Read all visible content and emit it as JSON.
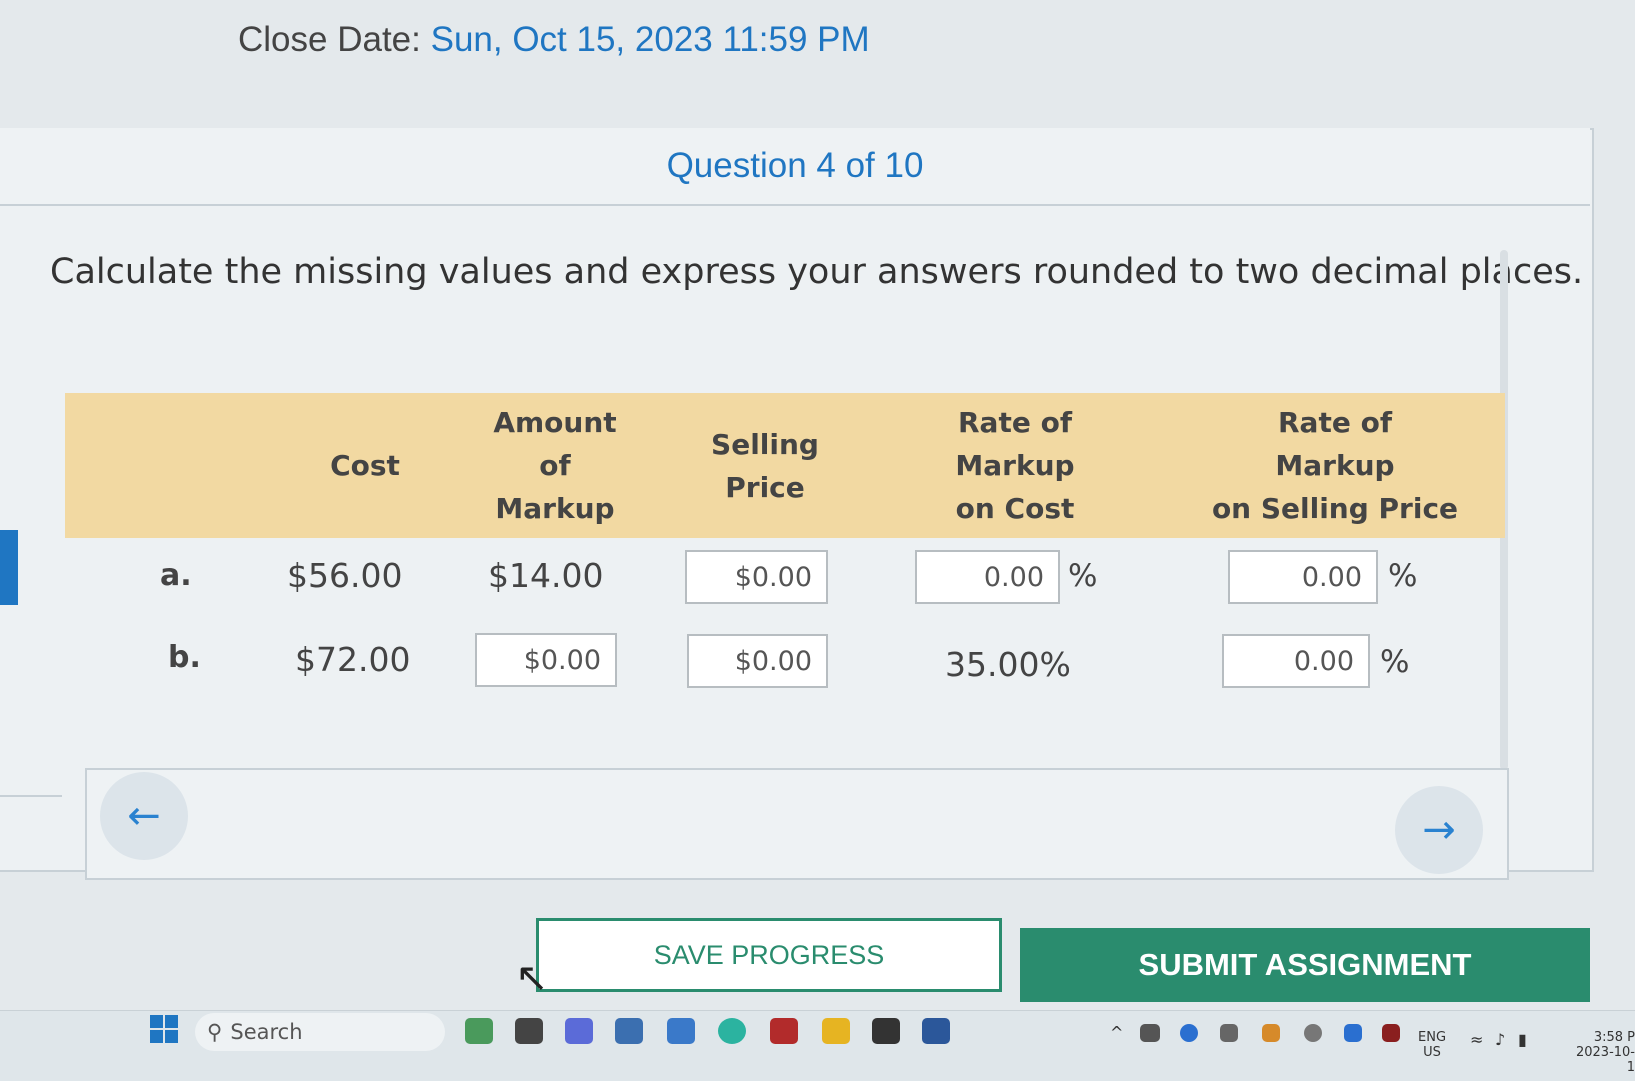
{
  "header": {
    "close_date_label": "Close Date:",
    "close_date_value": "Sun, Oct 15, 2023 11:59 PM"
  },
  "question": {
    "counter": "Question 4 of 10",
    "instructions": "Calculate the missing values and express your answers rounded to two decimal places."
  },
  "table": {
    "headers": {
      "cost": "Cost",
      "amount_line1": "Amount",
      "amount_line2": "of",
      "amount_line3": "Markup",
      "selling_line1": "Selling",
      "selling_line2": "Price",
      "rate_cost_line1": "Rate of",
      "rate_cost_line2": "Markup",
      "rate_cost_line3": "on Cost",
      "rate_sp_line1": "Rate of",
      "rate_sp_line2": "Markup",
      "rate_sp_line3": "on Selling Price"
    },
    "rows": [
      {
        "label": "a.",
        "cost": "$56.00",
        "amount_of_markup": "$14.00",
        "selling_price_input": "$0.00",
        "rate_on_cost_input": "0.00",
        "rate_on_selling_input": "0.00"
      },
      {
        "label": "b.",
        "cost": "$72.00",
        "amount_of_markup_input": "$0.00",
        "selling_price_input": "$0.00",
        "rate_on_cost": "35.00%",
        "rate_on_selling_input": "0.00"
      }
    ],
    "percent_sign": "%"
  },
  "navigation": {
    "prev_icon": "arrow-left-icon",
    "next_icon": "arrow-right-icon"
  },
  "actions": {
    "save_label": "SAVE PROGRESS",
    "submit_label": "SUBMIT ASSIGNMENT"
  },
  "taskbar": {
    "search_placeholder": "Search",
    "lang_line1": "ENG",
    "lang_line2": "US",
    "time": "3:58 P",
    "date": "2023-10-1"
  },
  "colors": {
    "accent_blue": "#1f76c2",
    "header_tan": "#f2d9a2",
    "button_green": "#2a8c6e"
  }
}
